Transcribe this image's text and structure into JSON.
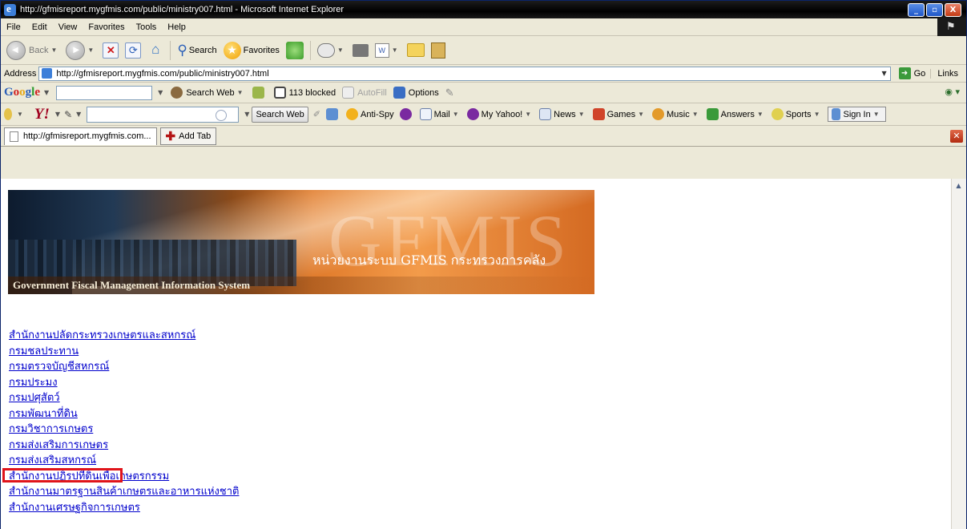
{
  "window": {
    "title": "http://gfmisreport.mygfmis.com/public/ministry007.html - Microsoft Internet Explorer",
    "controls": [
      "_",
      "▫",
      "X"
    ]
  },
  "menu": [
    "File",
    "Edit",
    "View",
    "Favorites",
    "Tools",
    "Help"
  ],
  "toolbar": {
    "back_label": "Back",
    "search_label": "Search",
    "favorites_label": "Favorites"
  },
  "address": {
    "label": "Address",
    "url": "http://gfmisreport.mygfmis.com/public/ministry007.html",
    "go_label": "Go",
    "links_label": "Links"
  },
  "googlebar": {
    "logo": "Google",
    "search_web": "Search Web",
    "blocked": "113 blocked",
    "autofill": "AutoFill",
    "options": "Options"
  },
  "yahoobar": {
    "logo": "Y!",
    "search_web": "Search Web",
    "antispy": "Anti-Spy",
    "mail": "Mail",
    "my_yahoo": "My Yahoo!",
    "news": "News",
    "games": "Games",
    "music": "Music",
    "answers": "Answers",
    "sports": "Sports",
    "sign_in": "Sign In"
  },
  "tabs": {
    "current": "http://gfmisreport.mygfmis.com...",
    "add_tab": "Add Tab"
  },
  "banner": {
    "big_text": "GFMIS",
    "thai_title": "หน่วยงานระบบ GFMIS กระทรวงการคลัง",
    "english_title": "Government Fiscal Management Information System"
  },
  "departments": [
    "สำนักงานปลัดกระทรวงเกษตรและสหกรณ์",
    "กรมชลประทาน",
    "กรมตรวจบัญชีสหกรณ์",
    "กรมประมง",
    "กรมปศุสัตว์",
    "กรมพัฒนาที่ดิน",
    "กรมวิชาการเกษตร",
    "กรมส่งเสริมการเกษตร",
    "กรมส่งเสริมสหกรณ์",
    "สำนักงานปฏิรูปที่ดินเพื่อเกษตรกรรม",
    "สำนักงานมาตรฐานสินค้าเกษตรและอาหารแห่งชาติ",
    "สำนักงานเศรษฐกิจการเกษตร"
  ],
  "highlighted_department": "กรมส่งเสริมสหกรณ์",
  "colors": {
    "link": "#0000cc",
    "highlight": "#e0141a"
  }
}
